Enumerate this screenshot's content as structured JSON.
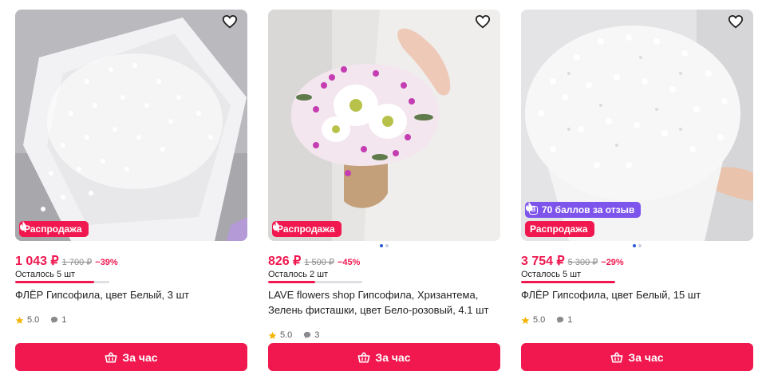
{
  "products": [
    {
      "price": "1 043 ₽",
      "old_price": "1 700 ₽",
      "discount": "−39%",
      "sale_badge": "Распродажа",
      "stock_text": "Осталось 5 шт",
      "stock_level": 0.84,
      "title": "ФЛЁР Гипсофила, цвет Белый, 3 шт",
      "rating": "5.0",
      "reviews": "1",
      "button_label": "За час"
    },
    {
      "price": "826 ₽",
      "old_price": "1 500 ₽",
      "discount": "−45%",
      "sale_badge": "Распродажа",
      "stock_text": "Осталось 2 шт",
      "stock_level": 0.5,
      "title": "LAVE flowers shop Гипсофила, Хризантема, Зелень фисташки, цвет Бело-розовый, 4.1 шт",
      "rating": "5.0",
      "reviews": "3",
      "button_label": "За час"
    },
    {
      "price": "3 754 ₽",
      "old_price": "5 300 ₽",
      "discount": "−29%",
      "sale_badge": "Распродажа",
      "points_badge": "70 баллов за отзыв",
      "stock_text": "Осталось 5 шт",
      "stock_level": 1.0,
      "title": "ФЛЁР Гипсофила, цвет Белый, 15 шт",
      "rating": "5.0",
      "reviews": "1",
      "button_label": "За час"
    }
  ],
  "icons": {
    "favorite": "heart-outline-icon",
    "sale": "flame-icon",
    "points": "points-b-icon",
    "rating": "star-icon",
    "reviews": "comment-bubble-icon",
    "button": "basket-icon"
  },
  "colors": {
    "accent": "#f0184f",
    "points_badge": "#7e55ec",
    "star": "#f4b400",
    "carousel_dot_active": "#2a5bd7"
  }
}
